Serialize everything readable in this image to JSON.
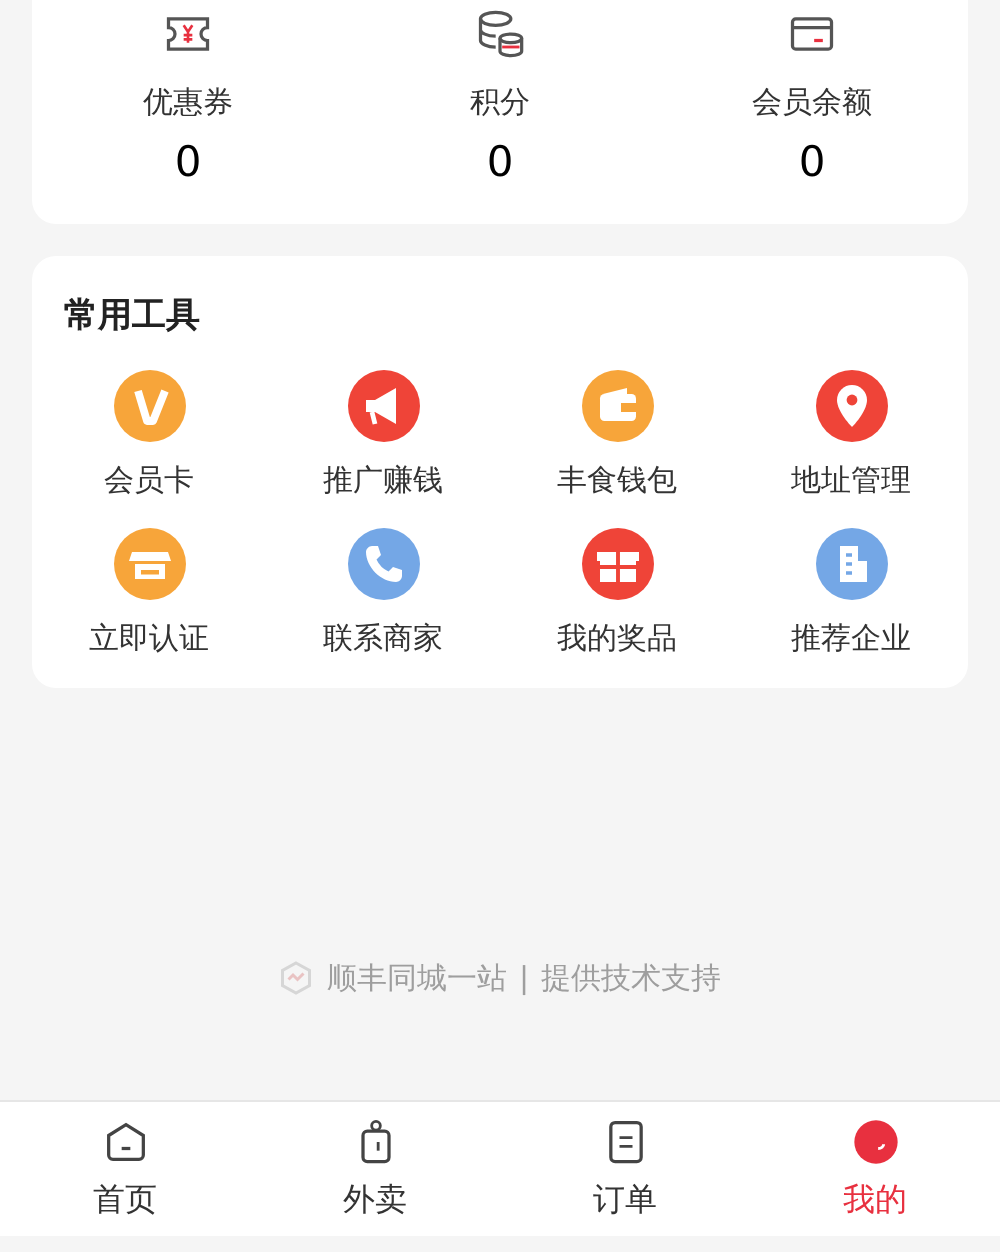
{
  "assets": [
    {
      "label": "优惠券",
      "value": "0"
    },
    {
      "label": "积分",
      "value": "0"
    },
    {
      "label": "会员余额",
      "value": "0"
    }
  ],
  "tools": {
    "title": "常用工具",
    "items": [
      {
        "label": "会员卡",
        "color": "#f7a53a"
      },
      {
        "label": "推广赚钱",
        "color": "#ef4438"
      },
      {
        "label": "丰食钱包",
        "color": "#f7a53a"
      },
      {
        "label": "地址管理",
        "color": "#ef4438"
      },
      {
        "label": "立即认证",
        "color": "#f7a53a"
      },
      {
        "label": "联系商家",
        "color": "#74a7e6"
      },
      {
        "label": "我的奖品",
        "color": "#ef4438"
      },
      {
        "label": "推荐企业",
        "color": "#74a7e6"
      }
    ]
  },
  "footer": {
    "brand": "顺丰同城一站",
    "separator": "|",
    "note": "提供技术支持"
  },
  "tabs": [
    {
      "label": "首页",
      "selected": false
    },
    {
      "label": "外卖",
      "selected": false
    },
    {
      "label": "订单",
      "selected": false
    },
    {
      "label": "我的",
      "selected": true
    }
  ]
}
